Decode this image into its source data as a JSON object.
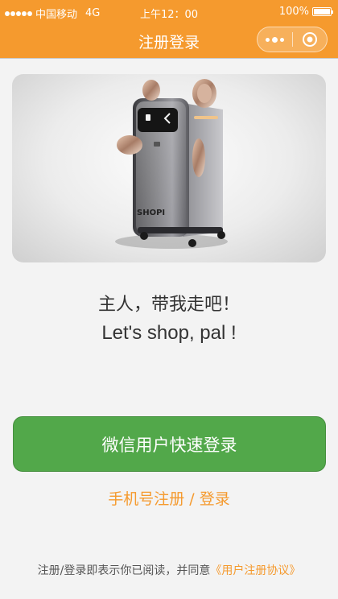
{
  "status_bar": {
    "carrier": "中国移动",
    "network": "4G",
    "time": "上午12：00",
    "battery": "100%",
    "battery_level": 1.0
  },
  "nav": {
    "title": "注册登录",
    "more_icon": "more-dots-icon",
    "close_icon": "circle-close-icon"
  },
  "hero": {
    "image": "smart-suitcase-robot-image",
    "brand_mark": "SHOPI"
  },
  "tagline": {
    "cn": "主人，带我走吧！",
    "en": "Let's shop, pal !"
  },
  "actions": {
    "wechat_login_label": "微信用户快速登录",
    "phone_register": "手机号注册",
    "separator": " / ",
    "phone_login": "登录"
  },
  "footer": {
    "notice": "注册/登录即表示你已阅读，并同意",
    "agreement_link": "《用户注册协议》"
  },
  "colors": {
    "accent": "#f59a2e",
    "primary_button": "#52a84a",
    "background": "#f3f3f3"
  }
}
